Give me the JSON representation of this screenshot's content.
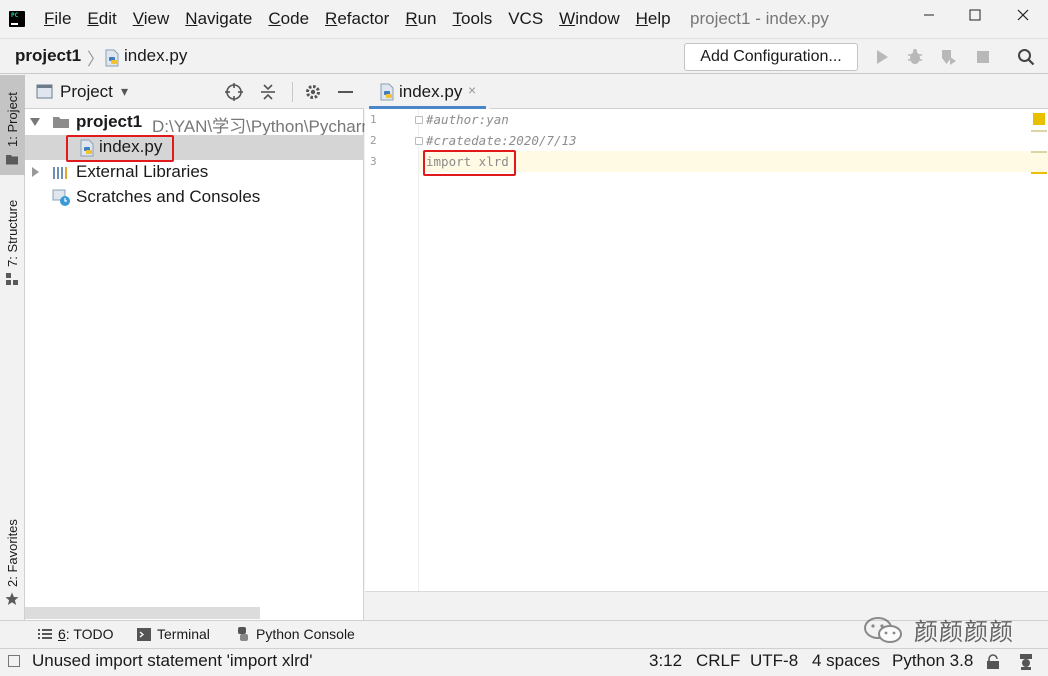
{
  "window": {
    "title": "project1 - index.py",
    "controls": [
      "minimize",
      "maximize",
      "close"
    ]
  },
  "menu": {
    "items": [
      {
        "underline": "F",
        "rest": "ile"
      },
      {
        "underline": "E",
        "rest": "dit"
      },
      {
        "underline": "V",
        "rest": "iew"
      },
      {
        "underline": "N",
        "rest": "avigate"
      },
      {
        "underline": "C",
        "rest": "ode"
      },
      {
        "underline": "R",
        "rest": "efactor"
      },
      {
        "underline": "R",
        "rest": "un"
      },
      {
        "underline": "T",
        "rest": "ools"
      },
      {
        "underline": "",
        "rest": "VCS"
      },
      {
        "underline": "W",
        "rest": "indow"
      },
      {
        "underline": "H",
        "rest": "elp"
      }
    ]
  },
  "navbar": {
    "project": "project1",
    "separator": "〉",
    "file": "index.py",
    "add_configuration": "Add Configuration..."
  },
  "left_stripe": {
    "project_tab": "1: Project",
    "structure_tab": "7: Structure",
    "favorites_tab": "2: Favorites"
  },
  "project_panel": {
    "title": "Project",
    "dropdown_arrow": "▾",
    "tree": {
      "root_name": "project1",
      "root_path": "D:\\YAN\\学习\\Python\\Pycharm",
      "file": "index.py",
      "external_libraries": "External Libraries",
      "scratches": "Scratches and Consoles"
    }
  },
  "editor": {
    "tab_label": "index.py",
    "tab_close": "×",
    "lines": [
      {
        "number": "1",
        "text": "#author:yan",
        "kind": "comment"
      },
      {
        "number": "2",
        "text": "#cratedate:2020/7/13",
        "kind": "comment"
      },
      {
        "number": "3",
        "text": "import xlrd",
        "kind": "unused"
      }
    ]
  },
  "bottom_tools": {
    "todo_prefix": "6",
    "todo_label": ": TODO",
    "terminal": "Terminal",
    "python_console": "Python Console"
  },
  "status": {
    "message": "Unused import statement 'import xlrd'",
    "position": "3:12",
    "line_separator": "CRLF",
    "encoding": "UTF-8",
    "indent": "4 spaces",
    "interpreter": "Python 3.8"
  },
  "watermark": {
    "text": "颜颜颜颜"
  },
  "colors": {
    "highlight_box": "#e01a1a",
    "current_line": "#fffae3",
    "warning_marker": "#e8c000",
    "tab_underline": "#4a86c8"
  }
}
